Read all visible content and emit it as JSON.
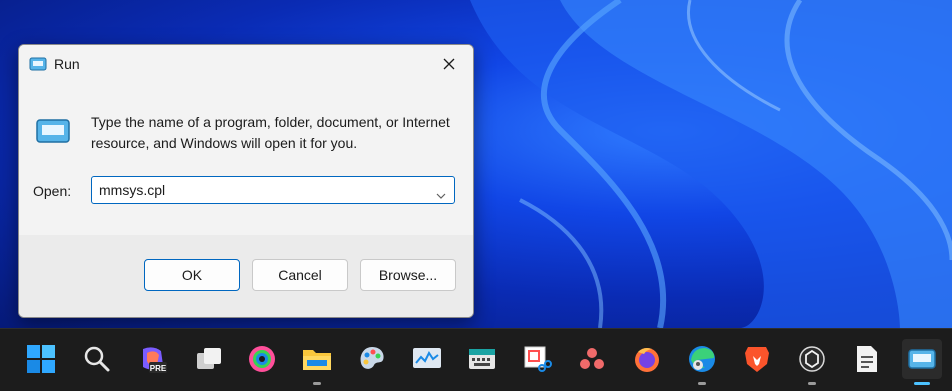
{
  "dialog": {
    "title": "Run",
    "description": "Type the name of a program, folder, document, or Internet resource, and Windows will open it for you.",
    "open_label": "Open:",
    "open_value": "mmsys.cpl",
    "ok_label": "OK",
    "cancel_label": "Cancel",
    "browse_label": "Browse..."
  },
  "taskbar": {
    "items": [
      {
        "name": "start-icon"
      },
      {
        "name": "search-icon"
      },
      {
        "name": "copilot-preview-icon",
        "badge": "PRE"
      },
      {
        "name": "task-view-icon"
      },
      {
        "name": "app-icon"
      },
      {
        "name": "file-explorer-icon"
      },
      {
        "name": "paint-icon"
      },
      {
        "name": "monitor-icon"
      },
      {
        "name": "keyboard-icon"
      },
      {
        "name": "snipping-tool-icon"
      },
      {
        "name": "asana-icon"
      },
      {
        "name": "firefox-icon"
      },
      {
        "name": "edge-icon"
      },
      {
        "name": "brave-icon"
      },
      {
        "name": "chatgpt-icon"
      },
      {
        "name": "document-icon"
      },
      {
        "name": "run-icon"
      }
    ]
  },
  "colors": {
    "accent": "#0067c0",
    "taskbar_active": "#4cc2ff"
  }
}
